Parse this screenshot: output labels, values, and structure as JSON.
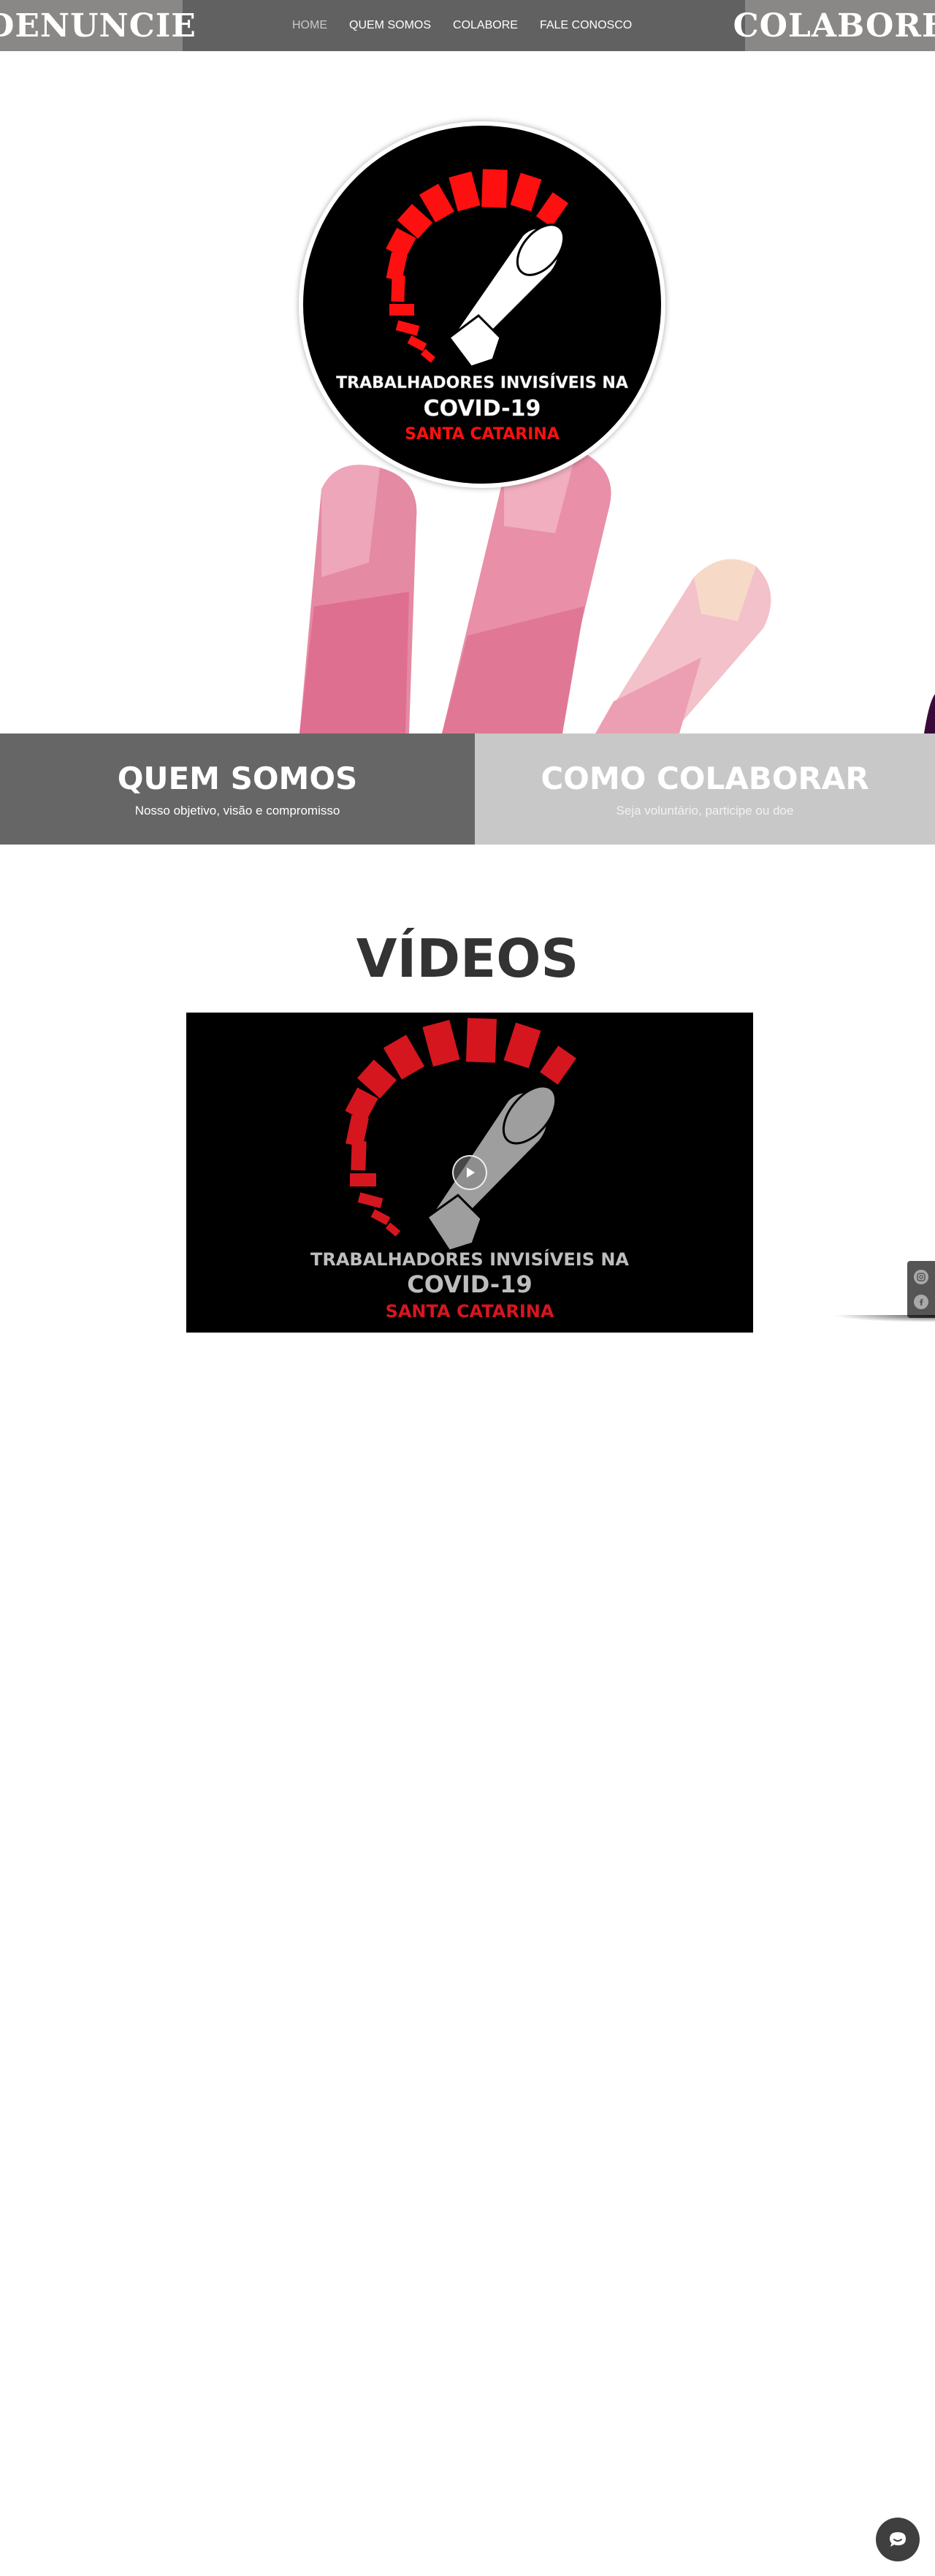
{
  "header": {
    "left_button": "DENUNCIE",
    "right_button": "COLABORE",
    "nav": [
      {
        "label": "HOME",
        "active": true
      },
      {
        "label": "QUEM SOMOS",
        "active": false
      },
      {
        "label": "COLABORE",
        "active": false
      },
      {
        "label": "FALE CONOSCO",
        "active": false
      }
    ]
  },
  "hero": {
    "logo": {
      "line1": "TRABALHADORES INVISÍVEIS NA",
      "line2": "COVID-19",
      "line3": "SANTA CATARINA"
    }
  },
  "bands": {
    "left": {
      "title": "QUEM SOMOS",
      "subtitle": "Nosso objetivo, visão e compromisso"
    },
    "right": {
      "title": "COMO COLABORAR",
      "subtitle": "Seja voluntário, participe ou doe"
    }
  },
  "videos": {
    "title": "VÍDEOS",
    "thumbnail": {
      "line1": "TRABALHADORES INVISÍVEIS NA",
      "line2": "COVID-19",
      "line3": "SANTA CATARINA"
    }
  },
  "social": {
    "icons": [
      "instagram-icon",
      "facebook-icon"
    ]
  },
  "colors": {
    "header_bg": "#616161",
    "tab_bg": "#8a8886",
    "band_left": "#666666",
    "band_right": "#c8c8c8",
    "logo_red": "#ff1010"
  }
}
